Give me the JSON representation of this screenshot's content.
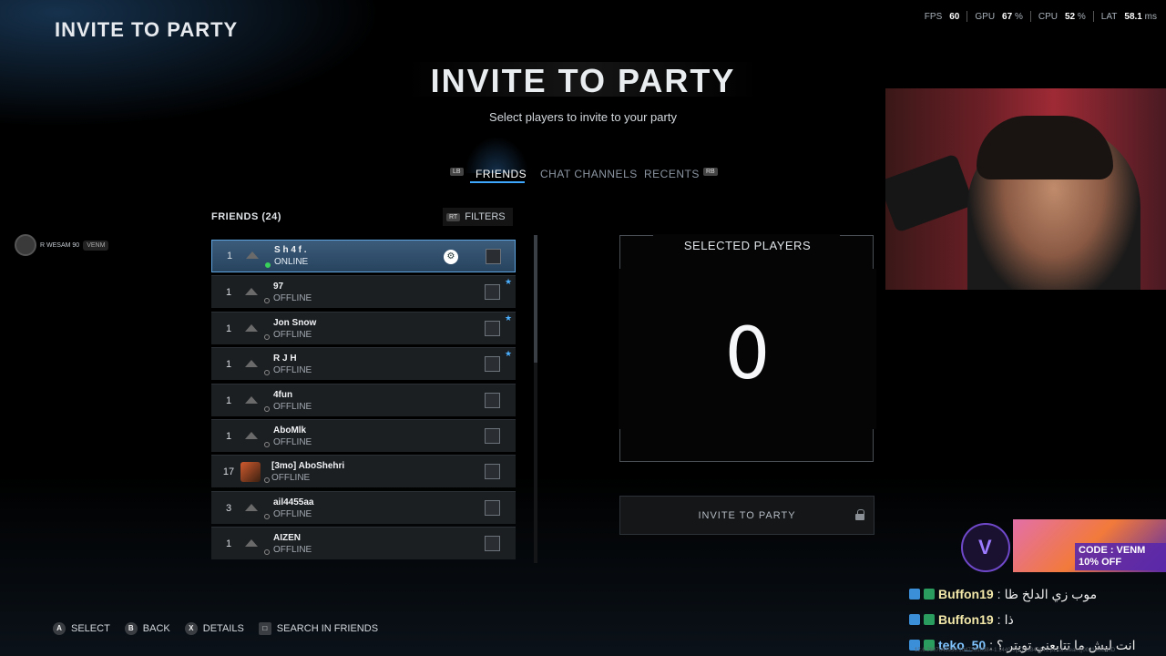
{
  "corner_title": "INVITE TO PARTY",
  "perf": {
    "fps_label": "FPS",
    "fps": "60",
    "gpu_label": "GPU",
    "gpu": "67",
    "cpu_label": "CPU",
    "cpu": "52",
    "lat_label": "LAT",
    "lat": "58.1",
    "pct": "%",
    "ms": "ms"
  },
  "title": "INVITE TO PARTY",
  "subtitle": "Select players to invite to your party",
  "tabs": {
    "lb": "LB",
    "rb": "RB",
    "items": [
      {
        "label": "FRIENDS",
        "active": true
      },
      {
        "label": "CHAT CHANNELS",
        "active": false
      },
      {
        "label": "RECENTS",
        "active": false
      }
    ]
  },
  "user_chip": {
    "name": "R WESAM 90",
    "clan": "VENM"
  },
  "friends": {
    "header": "FRIENDS (24)",
    "filters_key": "RT",
    "filters_label": "FILTERS",
    "rows": [
      {
        "rank": "1",
        "name": "S h 4 f .",
        "status": "ONLINE",
        "online": true,
        "steam": true,
        "star": false,
        "avatar": false
      },
      {
        "rank": "1",
        "name": "97",
        "status": "OFFLINE",
        "online": false,
        "steam": false,
        "star": true,
        "avatar": false
      },
      {
        "rank": "1",
        "name": "Jon Snow",
        "status": "OFFLINE",
        "online": false,
        "steam": false,
        "star": true,
        "avatar": false
      },
      {
        "rank": "1",
        "name": "R J H",
        "status": "OFFLINE",
        "online": false,
        "steam": false,
        "star": true,
        "avatar": false
      },
      {
        "rank": "1",
        "name": "4fun",
        "status": "OFFLINE",
        "online": false,
        "steam": false,
        "star": false,
        "avatar": false
      },
      {
        "rank": "1",
        "name": "AboMlk",
        "status": "OFFLINE",
        "online": false,
        "steam": false,
        "star": false,
        "avatar": false
      },
      {
        "rank": "17",
        "name": "[3mo] AboShehri",
        "status": "OFFLINE",
        "online": false,
        "steam": false,
        "star": false,
        "avatar": true
      },
      {
        "rank": "3",
        "name": "ail4455aa",
        "status": "OFFLINE",
        "online": false,
        "steam": false,
        "star": false,
        "avatar": false
      },
      {
        "rank": "1",
        "name": "AIZEN",
        "status": "OFFLINE",
        "online": false,
        "steam": false,
        "star": false,
        "avatar": false
      }
    ]
  },
  "selected": {
    "title": "SELECTED PLAYERS",
    "count": "0"
  },
  "invite_button": "INVITE TO PARTY",
  "bottom_bar": [
    {
      "key": "A",
      "label": "SELECT"
    },
    {
      "key": "B",
      "label": "BACK"
    },
    {
      "key": "X",
      "label": "DETAILS"
    },
    {
      "key": "□",
      "label": "SEARCH IN FRIENDS"
    }
  ],
  "promo": {
    "logo": "V",
    "code": "CODE : VENM",
    "discount": "10% OFF"
  },
  "chat": [
    {
      "user": "Buffon19",
      "message": "موب زي الدلخ ظا"
    },
    {
      "user": "Buffon19",
      "message": "ذا"
    },
    {
      "user": "teko_50",
      "message": "انت ليش ما تتابعني تويتر ؟"
    }
  ],
  "footer_id": "12.6.2607843930.10472810384-1.1440.0||7738840141.p1.ca.steam||0001B8B80D"
}
